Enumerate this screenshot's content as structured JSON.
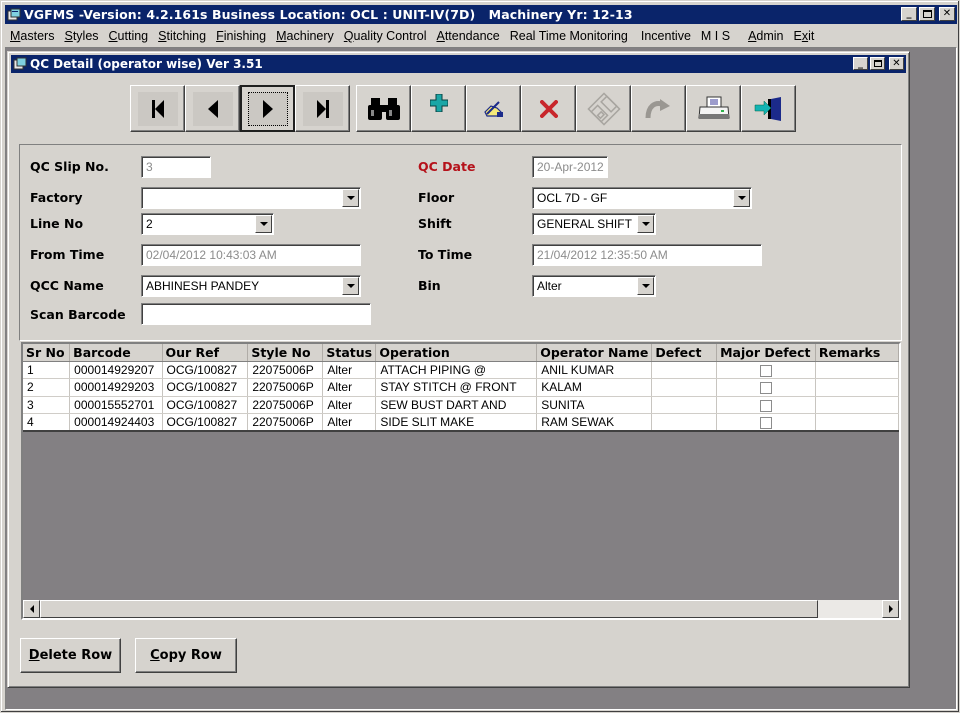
{
  "app": {
    "title": "VGFMS -Version: 4.2.161s Business Location: OCL : UNIT-IV(7D)   Machinery Yr: 12-13",
    "window_buttons": [
      "minimize",
      "maximize",
      "close"
    ]
  },
  "menu": [
    {
      "label": "Masters",
      "accel": "M"
    },
    {
      "label": "Styles",
      "accel": "S"
    },
    {
      "label": "Cutting",
      "accel": "C"
    },
    {
      "label": "Stitching",
      "accel": "S"
    },
    {
      "label": "Finishing",
      "accel": "F"
    },
    {
      "label": "Machinery",
      "accel": "M"
    },
    {
      "label": "Quality Control",
      "accel": "Q"
    },
    {
      "label": "Attendance",
      "accel": "A"
    },
    {
      "label": "Real Time Monitoring",
      "accel": ""
    },
    {
      "label": "Incentive",
      "accel": ""
    },
    {
      "label": "M I S",
      "accel": ""
    },
    {
      "label": "Admin",
      "accel": "A"
    },
    {
      "label": "Exit",
      "accel": "x"
    }
  ],
  "child_window": {
    "title": "QC Detail (operator wise) Ver 3.51"
  },
  "toolbar": [
    {
      "name": "first-record",
      "icon": "first-icon"
    },
    {
      "name": "previous-record",
      "icon": "previous-icon"
    },
    {
      "name": "next-record",
      "icon": "next-icon",
      "focused": true
    },
    {
      "name": "last-record",
      "icon": "last-icon"
    },
    {
      "name": "find",
      "icon": "binoculars-icon"
    },
    {
      "name": "add",
      "icon": "plus-icon"
    },
    {
      "name": "edit",
      "icon": "edit-hand-icon"
    },
    {
      "name": "delete",
      "icon": "delete-x-icon"
    },
    {
      "name": "save",
      "icon": "save-disk-icon",
      "disabled": true
    },
    {
      "name": "undo",
      "icon": "undo-arrow-icon",
      "disabled": true
    },
    {
      "name": "print",
      "icon": "printer-icon"
    },
    {
      "name": "exit",
      "icon": "exit-door-icon"
    }
  ],
  "form": {
    "qc_slip_no": {
      "label": "QC Slip No.",
      "value": "3"
    },
    "factory": {
      "label": "Factory",
      "value": ""
    },
    "line_no": {
      "label": "Line No",
      "value": "2"
    },
    "from_time": {
      "label": "From Time",
      "value": "02/04/2012 10:43:03 AM"
    },
    "qcc_name": {
      "label": "QCC Name",
      "value": "ABHINESH PANDEY"
    },
    "scan_barcode": {
      "label": "Scan Barcode",
      "value": ""
    },
    "qc_date": {
      "label": "QC Date",
      "value": "20-Apr-2012"
    },
    "floor": {
      "label": "Floor",
      "value": "OCL 7D - GF"
    },
    "shift": {
      "label": "Shift",
      "value": "GENERAL SHIFT"
    },
    "to_time": {
      "label": "To Time",
      "value": "21/04/2012 12:35:50 AM"
    },
    "bin": {
      "label": "Bin",
      "value": "Alter"
    }
  },
  "grid": {
    "columns": [
      "Sr No",
      "Barcode",
      "Our Ref",
      "Style No",
      "Status",
      "Operation",
      "Operator Name",
      "Defect",
      "Major Defect",
      "Remarks"
    ],
    "rows": [
      {
        "sr_no": "1",
        "barcode": "000014929207",
        "our_ref": "OCG/100827",
        "style_no": "22075006P",
        "status": "Alter",
        "operation": "ATTACH PIPING @",
        "operator_name": "ANIL KUMAR",
        "defect": "",
        "major_defect": false,
        "remarks": ""
      },
      {
        "sr_no": "2",
        "barcode": "000014929203",
        "our_ref": "OCG/100827",
        "style_no": "22075006P",
        "status": "Alter",
        "operation": "STAY STITCH @ FRONT",
        "operator_name": "KALAM",
        "defect": "",
        "major_defect": false,
        "remarks": ""
      },
      {
        "sr_no": "3",
        "barcode": "000015552701",
        "our_ref": "OCG/100827",
        "style_no": "22075006P",
        "status": "Alter",
        "operation": "SEW BUST DART AND",
        "operator_name": "SUNITA",
        "defect": "",
        "major_defect": false,
        "remarks": ""
      },
      {
        "sr_no": "4",
        "barcode": "000014924403",
        "our_ref": "OCG/100827",
        "style_no": "22075006P",
        "status": "Alter",
        "operation": "SIDE SLIT MAKE",
        "operator_name": "RAM SEWAK",
        "defect": "",
        "major_defect": false,
        "remarks": ""
      }
    ]
  },
  "buttons": {
    "delete_row": {
      "label": "Delete Row",
      "accel": "D"
    },
    "copy_row": {
      "label": "Copy Row",
      "accel": "C"
    }
  }
}
